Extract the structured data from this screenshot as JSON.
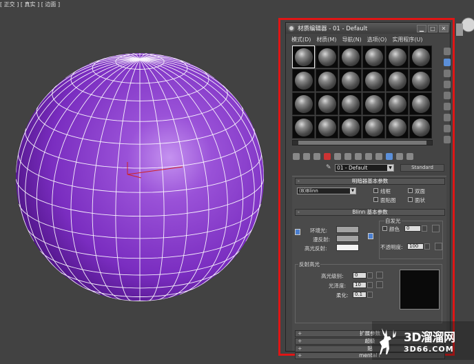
{
  "viewport": {
    "label": "[ 正交 ] [ 真实 ] [ 边面 ]",
    "sphere_color": "#7b2fc0",
    "wire_color": "#ffffff"
  },
  "window": {
    "title": "材质编辑器 - 01 - Default",
    "minimize": "▁",
    "maximize": "□",
    "close": "✕"
  },
  "menu": [
    "模式(D)",
    "材质(M)",
    "导航(N)",
    "选项(O)",
    "实用程序(U)"
  ],
  "material": {
    "name": "01 - Default",
    "type": "Standard"
  },
  "shader_basic": {
    "header": "明暗器基本参数",
    "shader": "(B)Blinn",
    "wire": "线框",
    "two_sided": "双面",
    "face_map": "面贴图",
    "faceted": "面状"
  },
  "blinn_basic": {
    "header": "Blinn 基本参数",
    "self_illum_group": "自发光",
    "color_label": "颜色",
    "color_value": "0",
    "ambient": "环境光:",
    "diffuse": "漫反射:",
    "specular": "高光反射:",
    "opacity_label": "不透明度:",
    "opacity_value": "100",
    "ambient_color": "#a3a3a3",
    "diffuse_color": "#a3a3a3",
    "specular_color": "#f2f2f2"
  },
  "spec_highlights": {
    "group": "反射高光",
    "level_label": "高光级别:",
    "level_value": "0",
    "gloss_label": "光泽度:",
    "gloss_value": "10",
    "soften_label": "柔化:",
    "soften_value": "0.1",
    "preview_color": "#0a0a0a"
  },
  "rollouts": [
    {
      "sign": "+",
      "label": "扩展参数"
    },
    {
      "sign": "+",
      "label": "超级"
    },
    {
      "sign": "+",
      "label": "贴"
    },
    {
      "sign": "+",
      "label": "mental r"
    }
  ],
  "rollout_minus": "-",
  "watermark": {
    "title": "3D溜溜网",
    "url": "3D66.COM"
  }
}
